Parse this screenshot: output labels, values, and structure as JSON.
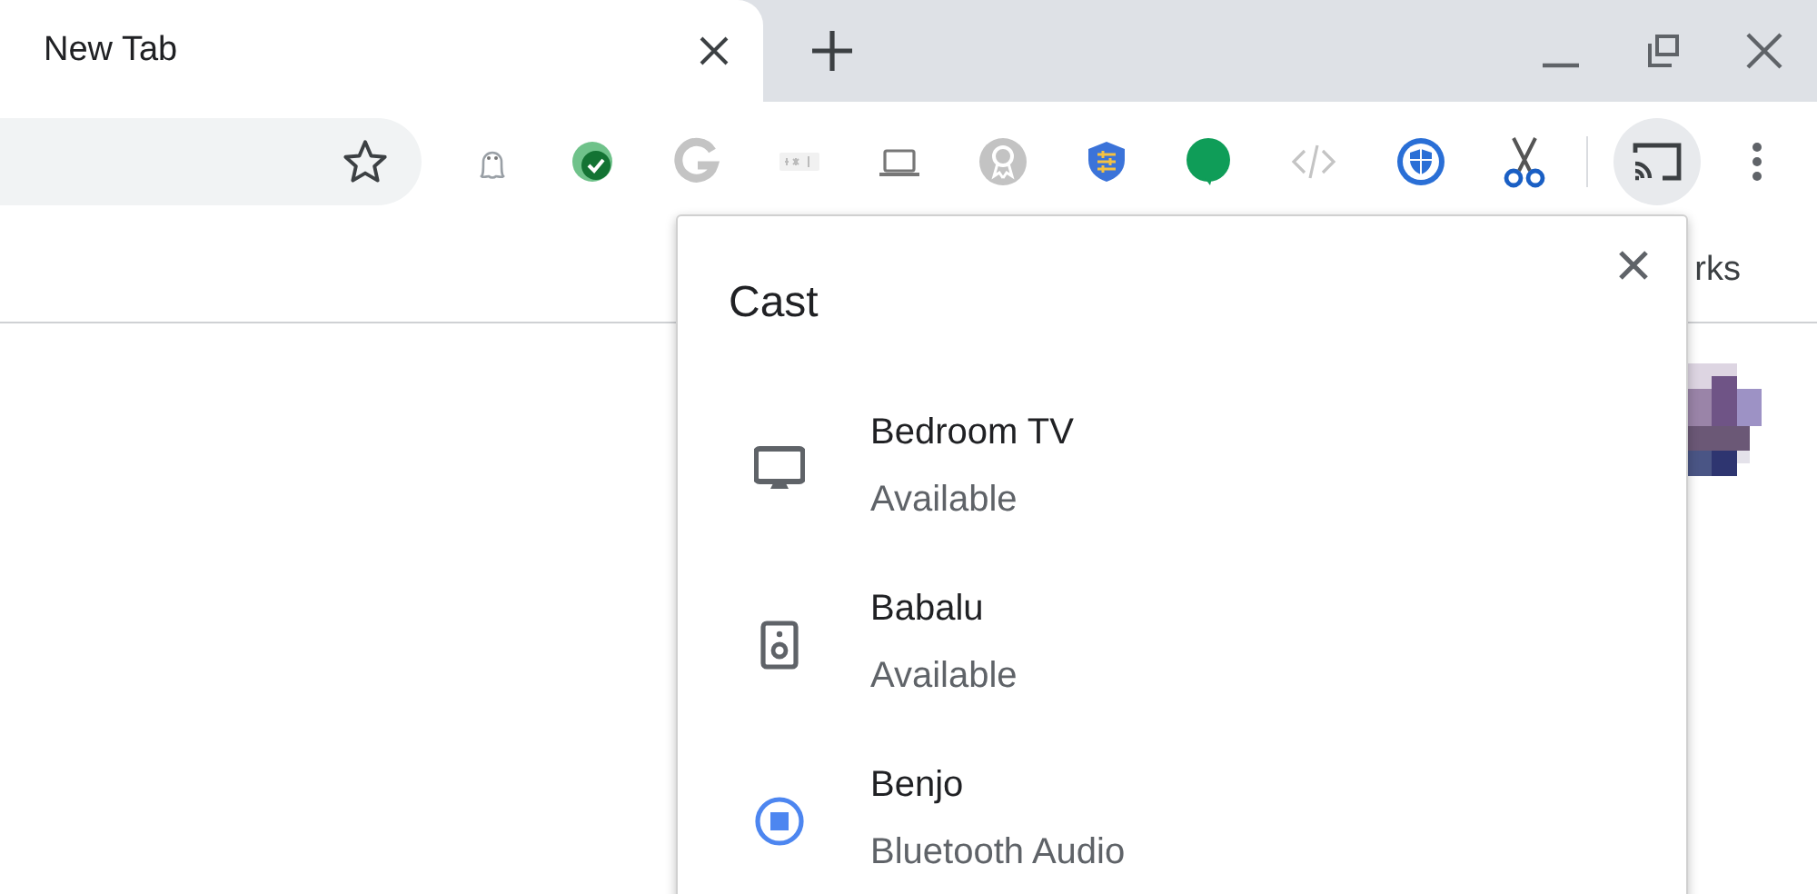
{
  "tabs": [
    {
      "title": "New Tab",
      "selected": true
    }
  ],
  "bookmarks_bar": {
    "text": "rks"
  },
  "cast_dialog": {
    "title": "Cast",
    "devices": [
      {
        "name": "Bedroom TV",
        "status": "Available",
        "kind": "tv"
      },
      {
        "name": "Babalu",
        "status": "Available",
        "kind": "speaker"
      },
      {
        "name": "Benjo",
        "status": "Bluetooth Audio",
        "kind": "active"
      }
    ]
  }
}
